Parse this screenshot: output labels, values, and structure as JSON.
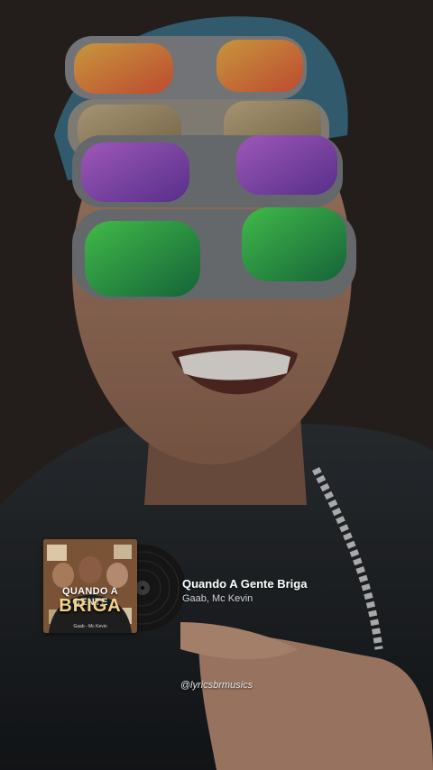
{
  "now_playing": {
    "song_title": "Quando A Gente Briga",
    "artists": "Gaab, Mc Kevin"
  },
  "cover_art": {
    "title_top": "QUANDO A GENTE",
    "title_bottom": "BRIGA",
    "credits": "Gaab - Mc Kevin"
  },
  "watermark": {
    "handle": "@lyricsbrmusics"
  },
  "icons": {
    "vinyl": "vinyl-record-icon"
  }
}
